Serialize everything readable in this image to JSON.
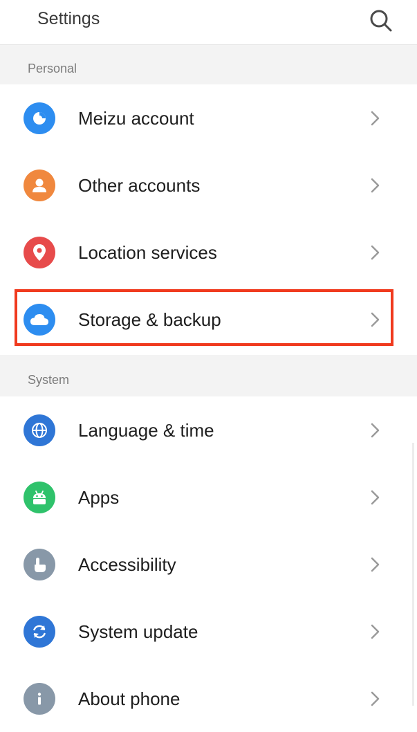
{
  "header": {
    "title": "Settings",
    "search_icon": "search-icon"
  },
  "sections": {
    "personal": {
      "title": "Personal",
      "items": [
        {
          "label": "Meizu account",
          "icon": "meizu-account-icon",
          "color": "#2d8df0"
        },
        {
          "label": "Other accounts",
          "icon": "person-icon",
          "color": "#f0883e"
        },
        {
          "label": "Location services",
          "icon": "location-pin-icon",
          "color": "#e74b4b"
        },
        {
          "label": "Storage & backup",
          "icon": "cloud-icon",
          "color": "#2d8df0",
          "highlighted": true
        }
      ]
    },
    "system": {
      "title": "System",
      "items": [
        {
          "label": "Language & time",
          "icon": "globe-icon",
          "color": "#2f76d6"
        },
        {
          "label": "Apps",
          "icon": "android-icon",
          "color": "#2fc26b"
        },
        {
          "label": "Accessibility",
          "icon": "hand-icon",
          "color": "#8898a8"
        },
        {
          "label": "System update",
          "icon": "refresh-icon",
          "color": "#2f76d6"
        },
        {
          "label": "About phone",
          "icon": "info-icon",
          "color": "#8898a8"
        }
      ]
    }
  },
  "colors": {
    "highlight_border": "#f03a1e",
    "section_bg": "#f3f3f3"
  }
}
